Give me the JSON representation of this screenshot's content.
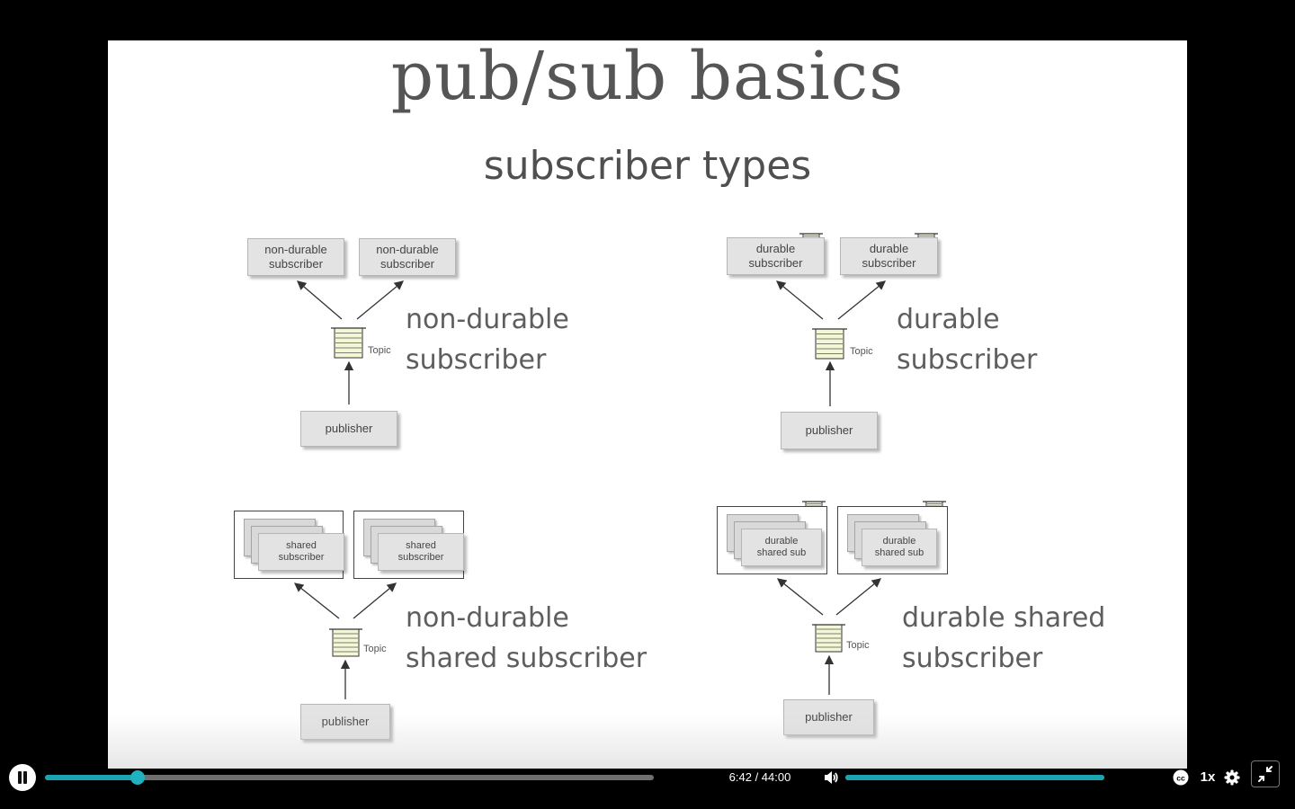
{
  "slide": {
    "title": "pub/sub basics",
    "subtitle": "subscriber types",
    "panels": [
      {
        "caption_lines": [
          "non-durable",
          "subscriber"
        ],
        "subscribers": [
          "non-durable\nsubscriber",
          "non-durable\nsubscriber"
        ],
        "topic_label": "Topic",
        "publisher": "publisher"
      },
      {
        "caption_lines": [
          "durable",
          "subscriber"
        ],
        "subscribers": [
          "durable\nsubscriber",
          "durable\nsubscriber"
        ],
        "topic_label": "Topic",
        "publisher": "publisher"
      },
      {
        "caption_lines": [
          "non-durable",
          "shared subscriber"
        ],
        "subscribers": [
          "shared\nsubscriber",
          "shared\nsubscriber"
        ],
        "topic_label": "Topic",
        "publisher": "publisher"
      },
      {
        "caption_lines": [
          "durable shared",
          "subscriber"
        ],
        "subscribers": [
          "durable\nshared sub",
          "durable\nshared sub"
        ],
        "topic_label": "Topic",
        "publisher": "publisher"
      }
    ]
  },
  "player": {
    "state": "playing",
    "current_time": "6:42",
    "duration": "44:00",
    "time_display": "6:42 / 44:00",
    "progress_fraction": 0.1523,
    "volume_fraction": 1.0,
    "speed": "1x",
    "icons": {
      "play_pause": "pause-icon",
      "volume": "volume-icon",
      "captions": "closed-captions-icon",
      "settings": "gear-icon",
      "fullscreen": "exit-fullscreen-icon"
    },
    "accent_color": "#1aa3b0"
  }
}
